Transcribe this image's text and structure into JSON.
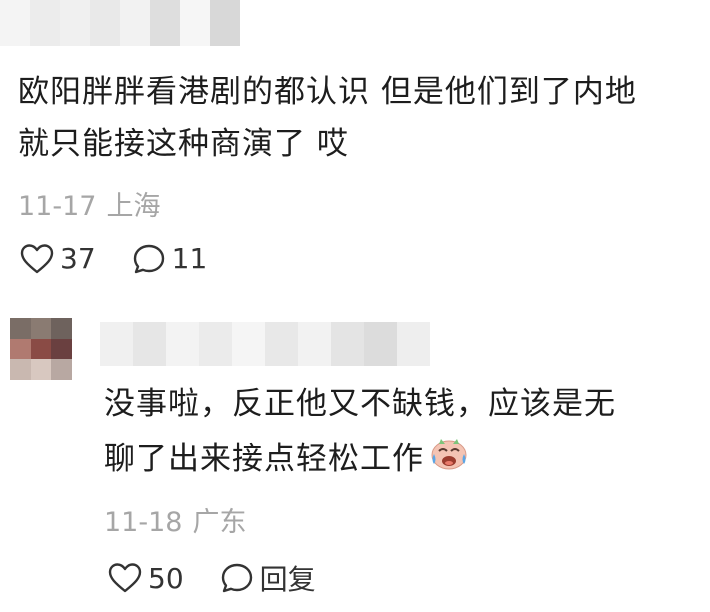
{
  "comments": [
    {
      "username": "",
      "text_line1": "欧阳胖胖看港剧的都认识 但是他们到了内地",
      "text_line2": "就只能接这种商演了 哎",
      "date": "11-17",
      "location": "上海",
      "likes": "37",
      "replies": "11"
    },
    {
      "username": "",
      "text_line1": "没事啦，反正他又不缺钱，应该是无",
      "text_line2": "聊了出来接点轻松工作",
      "emoji": "crying-laughing-pig-emoji",
      "date": "11-18",
      "location": "广东",
      "likes": "50",
      "reply_label": "回复"
    }
  ],
  "icons": {
    "like": "heart-outline-icon",
    "reply": "speech-bubble-icon"
  },
  "colors": {
    "text": "#1d1d1d",
    "meta": "#a6a6a6",
    "background": "#ffffff"
  }
}
